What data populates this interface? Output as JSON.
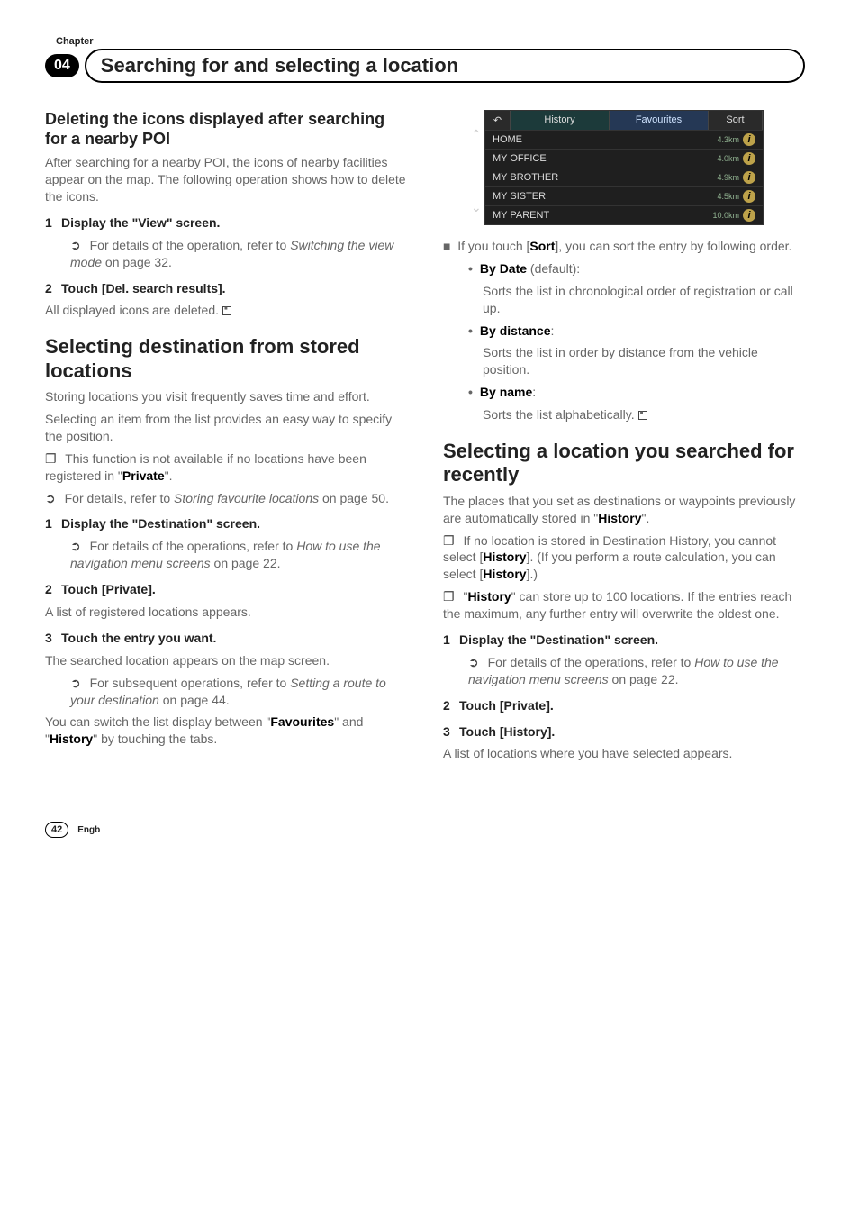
{
  "header": {
    "chapter_label": "Chapter",
    "chapter_num": "04",
    "title": "Searching for and selecting a location"
  },
  "left": {
    "del_title": "Deleting the icons displayed after searching for a nearby POI",
    "del_intro": "After searching for a nearby POI, the icons of nearby facilities appear on the map. The following operation shows how to delete the icons.",
    "del_step1": "Display the \"View\" screen.",
    "del_step1_ref": "For details of the operation, refer to ",
    "del_step1_ref_i": "Switching the view mode",
    "del_step1_ref_tail": " on page 32.",
    "del_step2": "Touch [Del. search results].",
    "del_step2_body": "All displayed icons are deleted.",
    "sel_title": "Selecting destination from stored locations",
    "sel_p1": "Storing locations you visit frequently saves time and effort.",
    "sel_p2": "Selecting an item from the list provides an easy way to specify the position.",
    "sel_note1a": "This function is not available if no locations have been registered in \"",
    "sel_note1b": "Private",
    "sel_note1c": "\".",
    "sel_ref1a": "For details, refer to ",
    "sel_ref1b": "Storing favourite locations",
    "sel_ref1c": " on page 50.",
    "sel_s1": "Display the \"Destination\" screen.",
    "sel_s1_refa": "For details of the operations, refer to ",
    "sel_s1_refb": "How to use the navigation menu screens",
    "sel_s1_refc": " on page 22.",
    "sel_s2": "Touch [Private].",
    "sel_s2_body": "A list of registered locations appears.",
    "sel_s3": "Touch the entry you want.",
    "sel_s3_body": "The searched location appears on the map screen.",
    "sel_s3_refa": "For subsequent operations, refer to ",
    "sel_s3_refb": "Setting a route to your destination",
    "sel_s3_refc": " on page 44.",
    "sel_tail_a": "You can switch the list display between \"",
    "sel_tail_b": "Favourites",
    "sel_tail_c": "\" and \"",
    "sel_tail_d": "History",
    "sel_tail_e": "\" by touching the tabs."
  },
  "shot": {
    "back": "↶",
    "history": "History",
    "favourites": "Favourites",
    "sort": "Sort",
    "rows": [
      {
        "name": "HOME",
        "km": "4.3km"
      },
      {
        "name": "MY OFFICE",
        "km": "4.0km"
      },
      {
        "name": "MY BROTHER",
        "km": "4.9km"
      },
      {
        "name": "MY SISTER",
        "km": "4.5km"
      },
      {
        "name": "MY PARENT",
        "km": "10.0km"
      }
    ]
  },
  "right": {
    "sort_intro_a": "If you touch [",
    "sort_intro_b": "Sort",
    "sort_intro_c": "], you can sort the entry by following order.",
    "opt1_t": "By Date",
    "opt1_def": " (default):",
    "opt1_body": "Sorts the list in chronological order of registration or call up.",
    "opt2_t": "By distance",
    "opt2_colon": ":",
    "opt2_body": "Sorts the list in order by distance from the vehicle position.",
    "opt3_t": "By name",
    "opt3_colon": ":",
    "opt3_body": "Sorts the list alphabetically.",
    "loc_title": "Selecting a location you searched for recently",
    "loc_p1_a": "The places that you set as destinations or waypoints previously are automatically stored in \"",
    "loc_p1_b": "History",
    "loc_p1_c": "\".",
    "loc_n1_a": "If no location is stored in Destination History, you cannot select [",
    "loc_n1_b": "History",
    "loc_n1_c": "]. (If you perform a route calculation, you can select [",
    "loc_n1_d": "History",
    "loc_n1_e": "].)",
    "loc_n2_a": "\"",
    "loc_n2_b": "History",
    "loc_n2_c": "\" can store up to 100 locations. If the entries reach the maximum, any further entry will overwrite the oldest one.",
    "loc_s1": "Display the \"Destination\" screen.",
    "loc_s1_refa": "For details of the operations, refer to ",
    "loc_s1_refb": "How to use the navigation menu screens",
    "loc_s1_refc": " on page 22.",
    "loc_s2": "Touch [Private].",
    "loc_s3": "Touch [History].",
    "loc_s3_body": "A list of locations where you have selected appears."
  },
  "footer": {
    "page": "42",
    "lang": "Engb"
  }
}
